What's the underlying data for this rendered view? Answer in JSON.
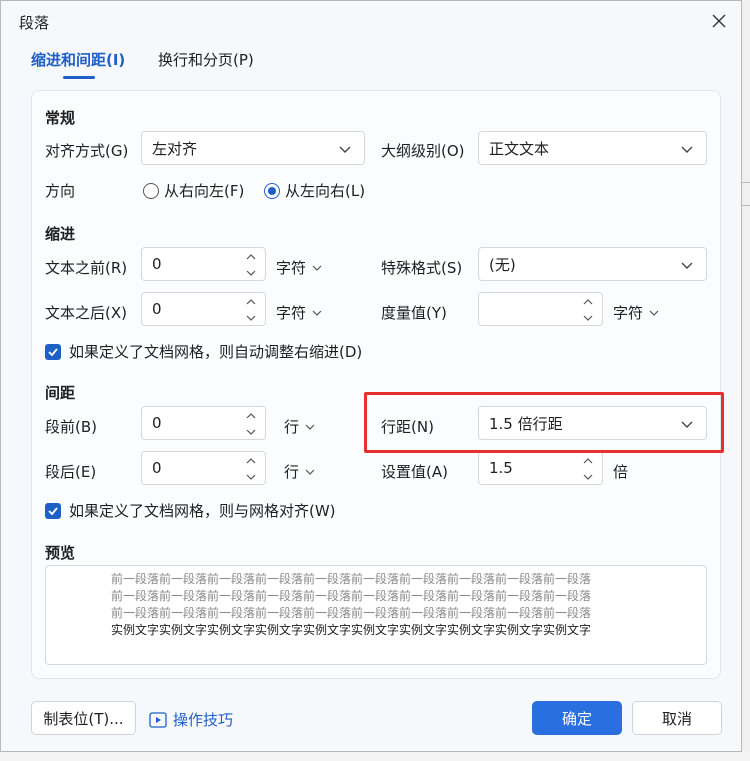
{
  "dialog": {
    "title": "段落",
    "close_label": "×"
  },
  "tabs": [
    {
      "label": "缩进和间距(I)",
      "active": true
    },
    {
      "label": "换行和分页(P)",
      "active": false
    }
  ],
  "general": {
    "heading": "常规",
    "alignment_label": "对齐方式(G)",
    "alignment_value": "左对齐",
    "outline_label": "大纲级别(O)",
    "outline_value": "正文文本",
    "direction_label": "方向",
    "direction_rtl": "从右向左(F)",
    "direction_ltr": "从左向右(L)",
    "direction_selected": "ltr"
  },
  "indent": {
    "heading": "缩进",
    "before_label": "文本之前(R)",
    "before_value": "0",
    "before_unit": "字符",
    "after_label": "文本之后(X)",
    "after_value": "0",
    "after_unit": "字符",
    "special_label": "特殊格式(S)",
    "special_value": "(无)",
    "measure_label": "度量值(Y)",
    "measure_value": "",
    "measure_unit": "字符",
    "auto_adjust_label": "如果定义了文档网格，则自动调整右缩进(D)",
    "auto_adjust_checked": true
  },
  "spacing": {
    "heading": "间距",
    "before_label": "段前(B)",
    "before_value": "0",
    "before_unit": "行",
    "after_label": "段后(E)",
    "after_value": "0",
    "after_unit": "行",
    "line_label": "行距(N)",
    "line_value": "1.5 倍行距",
    "set_label": "设置值(A)",
    "set_value": "1.5",
    "set_unit": "倍",
    "snap_grid_label": "如果定义了文档网格，则与网格对齐(W)",
    "snap_grid_checked": true
  },
  "preview": {
    "heading": "预览",
    "lines": [
      "前一段落前一段落前一段落前一段落前一段落前一段落前一段落前一段落前一段落前一段落",
      "前一段落前一段落前一段落前一段落前一段落前一段落前一段落前一段落前一段落前一段落",
      "前一段落前一段落前一段落前一段落前一段落前一段落前一段落前一段落前一段落前一段落",
      "实例文字实例文字实例文字实例文字实例文字实例文字实例文字实例文字实例文字实例文字"
    ]
  },
  "footer": {
    "tabs_button": "制表位(T)...",
    "tips_link": "操作技巧",
    "ok_button": "确定",
    "cancel_button": "取消"
  },
  "colors": {
    "accent": "#1f5fc8",
    "primary_button": "#2a6fe0",
    "highlight": "#e5302e"
  }
}
